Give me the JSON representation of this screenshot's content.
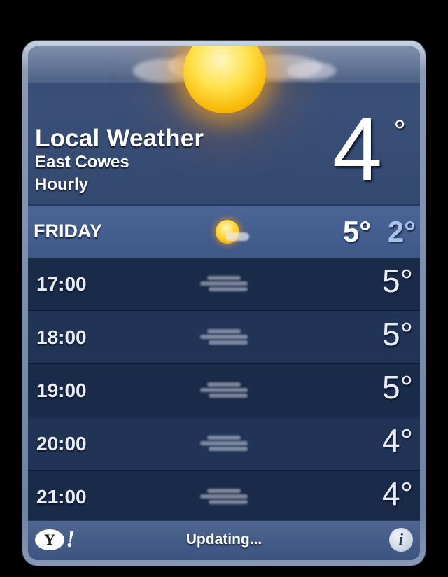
{
  "header": {
    "title": "Local Weather",
    "location": "East Cowes",
    "mode": "Hourly",
    "current_temp": "4",
    "degree_symbol": "°",
    "condition_icon": "sun-with-clouds-icon"
  },
  "day": {
    "label": "FRIDAY",
    "icon": "sun-partly-cloudy-icon",
    "high": "5°",
    "low": "2°"
  },
  "hours": [
    {
      "time": "17:00",
      "icon": "fog-icon",
      "temp": "5°"
    },
    {
      "time": "18:00",
      "icon": "fog-icon",
      "temp": "5°"
    },
    {
      "time": "19:00",
      "icon": "fog-icon",
      "temp": "5°"
    },
    {
      "time": "20:00",
      "icon": "fog-icon",
      "temp": "4°"
    },
    {
      "time": "21:00",
      "icon": "fog-icon",
      "temp": "4°"
    }
  ],
  "footer": {
    "logo_text": "Y",
    "logo_exclaim": "!",
    "status": "Updating...",
    "info_label": "i"
  },
  "colors": {
    "low_temp": "#a9c3ec",
    "sun": "#ffd22e"
  }
}
